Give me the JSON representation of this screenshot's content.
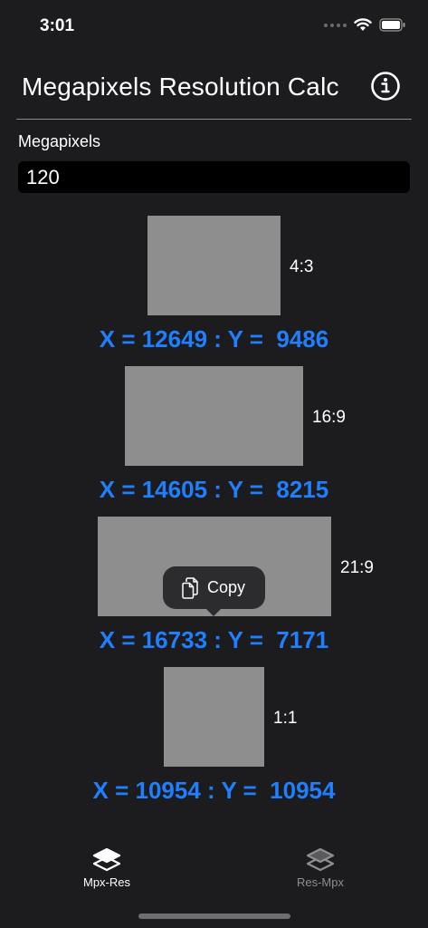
{
  "status": {
    "time": "3:01"
  },
  "header": {
    "title": "Megapixels Resolution Calc"
  },
  "input": {
    "label": "Megapixels",
    "value": "120"
  },
  "ratios": [
    {
      "label": "4:3",
      "result": "X = 12649 : Y =  9486"
    },
    {
      "label": "16:9",
      "result": "X = 14605 : Y =  8215"
    },
    {
      "label": "21:9",
      "result": "X = 16733 : Y =  7171"
    },
    {
      "label": "1:1",
      "result": "X = 10954 : Y =  10954"
    }
  ],
  "popup": {
    "label": "Copy"
  },
  "tabs": [
    {
      "label": "Mpx-Res",
      "active": true
    },
    {
      "label": "Res-Mpx",
      "active": false
    }
  ],
  "colors": {
    "accent": "#1f7fff",
    "background": "#1c1c1e",
    "box": "#8e8e8e"
  }
}
